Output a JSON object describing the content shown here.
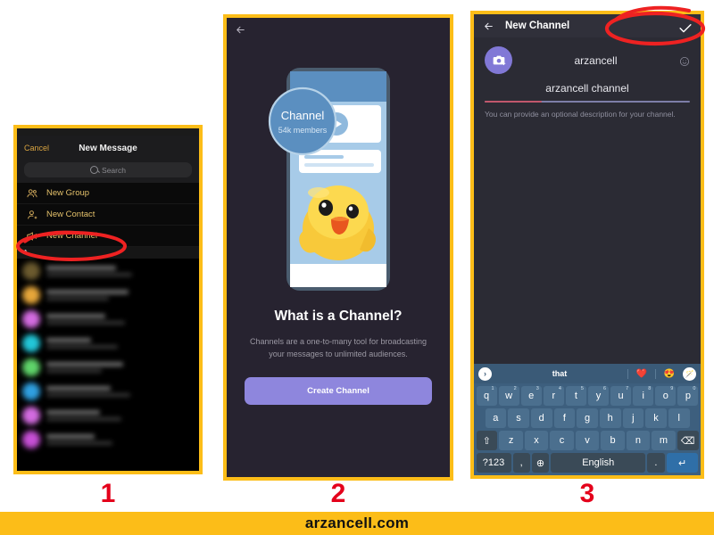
{
  "footer": {
    "watermark": "arzancell.com"
  },
  "steps": {
    "one": "1",
    "two": "2",
    "three": "3"
  },
  "panel1": {
    "nav": {
      "cancel": "Cancel",
      "title": "New Message"
    },
    "search": {
      "placeholder": "Search",
      "icon": "search-icon"
    },
    "actions": [
      {
        "label": "New Group",
        "icon": "new-group-icon"
      },
      {
        "label": "New Contact",
        "icon": "new-contact-icon"
      },
      {
        "label": "New Channel",
        "icon": "megaphone-icon"
      }
    ],
    "section_header": "A",
    "contacts_blurred": [
      {
        "avatar_color": "#6b5a2e"
      },
      {
        "avatar_color": "#e0a game"
      },
      {
        "avatar_color": "#d36be0"
      },
      {
        "avatar_color": "#22c6d8"
      },
      {
        "avatar_color": "#5fd46a"
      },
      {
        "avatar_color": "#2f9fe0"
      },
      {
        "avatar_color": "#d36be0"
      },
      {
        "avatar_color": "#c74fd6"
      }
    ]
  },
  "panel2": {
    "nav": {
      "back_icon": "arrow-back-icon"
    },
    "illustration": {
      "bubble_title": "Channel",
      "bubble_subtitle": "54k members"
    },
    "heading": "What is a Channel?",
    "paragraph": "Channels are a one-to-many tool for broadcasting your messages to unlimited audiences.",
    "cta": {
      "label": "Create Channel",
      "color": "#8e86dd"
    }
  },
  "panel3": {
    "nav": {
      "back_icon": "arrow-back-icon",
      "title": "New Channel",
      "confirm_icon": "check-icon"
    },
    "avatar": {
      "icon": "camera-add-icon",
      "color": "#8178d6"
    },
    "channel_name": {
      "value": "arzancell",
      "emoji_icon": "smiley-icon"
    },
    "description": {
      "value": "arzancell channel"
    },
    "hint": "You can provide an optional description for your channel.",
    "keyboard": {
      "suggestion": {
        "chevron": "›",
        "word": "that",
        "emoji1": "❤️",
        "emoji2": "😍",
        "wand": "🪄"
      },
      "row1": [
        {
          "k": "q",
          "sup": "1"
        },
        {
          "k": "w",
          "sup": "2"
        },
        {
          "k": "e",
          "sup": "3"
        },
        {
          "k": "r",
          "sup": "4"
        },
        {
          "k": "t",
          "sup": "5"
        },
        {
          "k": "y",
          "sup": "6"
        },
        {
          "k": "u",
          "sup": "7"
        },
        {
          "k": "i",
          "sup": "8"
        },
        {
          "k": "o",
          "sup": "9"
        },
        {
          "k": "p",
          "sup": "0"
        }
      ],
      "row2": [
        {
          "k": "a"
        },
        {
          "k": "s"
        },
        {
          "k": "d"
        },
        {
          "k": "f"
        },
        {
          "k": "g"
        },
        {
          "k": "h"
        },
        {
          "k": "j"
        },
        {
          "k": "k"
        },
        {
          "k": "l"
        }
      ],
      "row3": [
        {
          "k": "⇧",
          "fn": true,
          "name": "shift-key"
        },
        {
          "k": "z"
        },
        {
          "k": "x"
        },
        {
          "k": "c"
        },
        {
          "k": "v"
        },
        {
          "k": "b"
        },
        {
          "k": "n"
        },
        {
          "k": "m"
        },
        {
          "k": "⌫",
          "fn": true,
          "name": "backspace-key"
        }
      ],
      "row4": {
        "symbols": "?123",
        "comma": ",",
        "globe": "⊕",
        "space": "English",
        "period": ".",
        "enter": "↵"
      }
    }
  },
  "annotations": {
    "ellipse1": "highlight-new-channel",
    "ellipse3": "highlight-confirm-check",
    "color": "#ee2222"
  }
}
